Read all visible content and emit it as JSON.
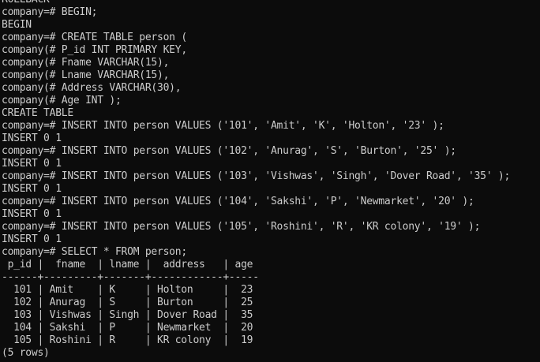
{
  "window": {
    "background": "#0c0c0c",
    "text_color": "#cccccc"
  },
  "terminal": {
    "lines": [
      {
        "prompt": "",
        "text": "ROLLBACK"
      },
      {
        "prompt": "company=# ",
        "text": "BEGIN;"
      },
      {
        "prompt": "",
        "text": "BEGIN"
      },
      {
        "prompt": "company=# ",
        "text": "CREATE TABLE person ("
      },
      {
        "prompt": "company(# ",
        "text": "P_id INT PRIMARY KEY,"
      },
      {
        "prompt": "company(# ",
        "text": "Fname VARCHAR(15),"
      },
      {
        "prompt": "company(# ",
        "text": "Lname VARCHAR(15),"
      },
      {
        "prompt": "company(# ",
        "text": "Address VARCHAR(30),"
      },
      {
        "prompt": "company(# ",
        "text": "Age INT );"
      },
      {
        "prompt": "",
        "text": "CREATE TABLE"
      },
      {
        "prompt": "company=# ",
        "text": "INSERT INTO person VALUES ('101', 'Amit', 'K', 'Holton', '23' );"
      },
      {
        "prompt": "",
        "text": "INSERT 0 1"
      },
      {
        "prompt": "company=# ",
        "text": "INSERT INTO person VALUES ('102', 'Anurag', 'S', 'Burton', '25' );"
      },
      {
        "prompt": "",
        "text": "INSERT 0 1"
      },
      {
        "prompt": "company=# ",
        "text": "INSERT INTO person VALUES ('103', 'Vishwas', 'Singh', 'Dover Road', '35' );"
      },
      {
        "prompt": "",
        "text": "INSERT 0 1"
      },
      {
        "prompt": "company=# ",
        "text": "INSERT INTO person VALUES ('104', 'Sakshi', 'P', 'Newmarket', '20' );"
      },
      {
        "prompt": "",
        "text": "INSERT 0 1"
      },
      {
        "prompt": "company=# ",
        "text": "INSERT INTO person VALUES ('105', 'Roshini', 'R', 'KR colony', '19' );"
      },
      {
        "prompt": "",
        "text": "INSERT 0 1"
      },
      {
        "prompt": "company=# ",
        "text": "SELECT * FROM person;"
      },
      {
        "prompt": "",
        "text": " p_id |  fname  | lname |  address   | age "
      },
      {
        "prompt": "",
        "text": "------+---------+-------+------------+-----"
      },
      {
        "prompt": "",
        "text": "  101 | Amit    | K     | Holton     |  23"
      },
      {
        "prompt": "",
        "text": "  102 | Anurag  | S     | Burton     |  25"
      },
      {
        "prompt": "",
        "text": "  103 | Vishwas | Singh | Dover Road |  35"
      },
      {
        "prompt": "",
        "text": "  104 | Sakshi  | P     | Newmarket  |  20"
      },
      {
        "prompt": "",
        "text": "  105 | Roshini | R     | KR colony  |  19"
      },
      {
        "prompt": "",
        "text": "(5 rows)"
      }
    ]
  }
}
